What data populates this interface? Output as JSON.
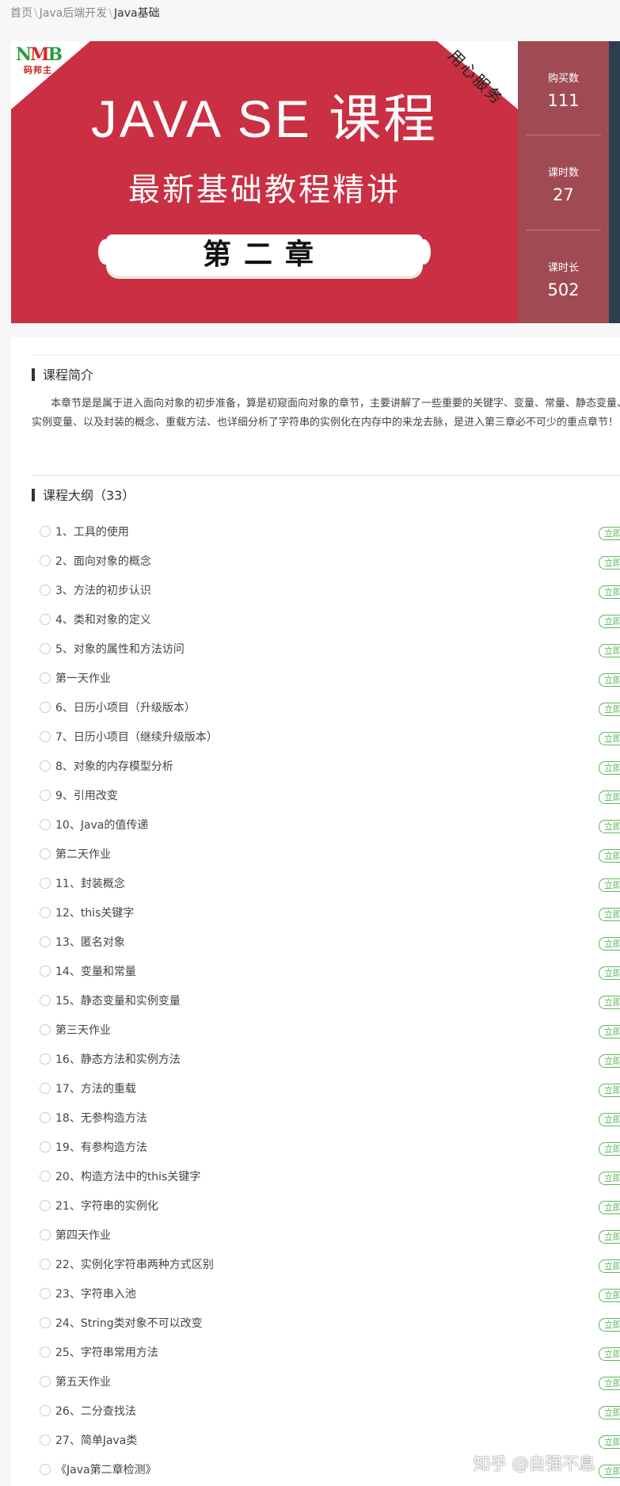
{
  "breadcrumb": {
    "home": "首页",
    "category": "Java后端开发",
    "current": "Java基础"
  },
  "banner": {
    "logo_mark_1": "N",
    "logo_mark_2": "M",
    "logo_mark_3": "B",
    "logo_sub": "码邦主",
    "corner_text": "用心服务",
    "title": "JAVA SE 课程",
    "subtitle": "最新基础教程精讲",
    "chapter": "第二章"
  },
  "stats": [
    {
      "label": "购买数",
      "value": "111"
    },
    {
      "label": "课时数",
      "value": "27"
    },
    {
      "label": "课时长",
      "value": "502"
    }
  ],
  "intro": {
    "heading": "课程简介",
    "text": "本章节是是属于进入面向对象的初步准备，算是初窥面向对象的章节，主要讲解了一些重要的关键字、变量、常量、静态变量、实例变量、以及封装的概念、重载方法、也详细分析了字符串的实例化在内存中的来龙去脉，是进入第三章必不可少的重点章节！"
  },
  "syllabus": {
    "heading": "课程大纲（33）",
    "button_label": "立即学习",
    "lessons": [
      "1、工具的使用",
      "2、面向对象的概念",
      "3、方法的初步认识",
      "4、类和对象的定义",
      "5、对象的属性和方法访问",
      "第一天作业",
      "6、日历小项目（升级版本）",
      "7、日历小项目（继续升级版本）",
      "8、对象的内存模型分析",
      "9、引用改变",
      "10、Java的值传递",
      "第二天作业",
      "11、封装概念",
      "12、this关键字",
      "13、匿名对象",
      "14、变量和常量",
      "15、静态变量和实例变量",
      "第三天作业",
      "16、静态方法和实例方法",
      "17、方法的重载",
      "18、无参构造方法",
      "19、有参构造方法",
      "20、构造方法中的this关键字",
      "21、字符串的实例化",
      "第四天作业",
      "22、实例化字符串两种方式区别",
      "23、字符串入池",
      "24、String类对象不可以改变",
      "25、字符串常用方法",
      "第五天作业",
      "26、二分查找法",
      "27、简单Java类",
      "《Java第二章检测》"
    ]
  },
  "watermark": "知乎 @自强不息",
  "colors": {
    "banner_red": "#cb2f43",
    "stats_bg": "#a04b54",
    "accent_green": "#5cb85c"
  }
}
